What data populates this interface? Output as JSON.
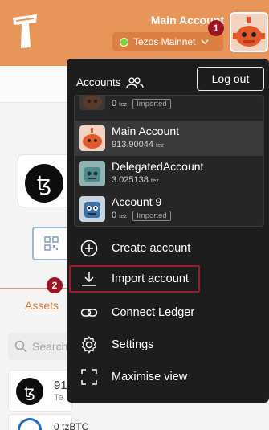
{
  "header": {
    "account_name": "Main Account",
    "network": "Tezos Mainnet",
    "network_status_color": "#7dd23a",
    "brand_color": "#e8955a"
  },
  "badges": [
    "1",
    "2"
  ],
  "background": {
    "assets_tab": "Assets",
    "search_placeholder": "Search",
    "asset_amount": "91",
    "asset_sub": "Te",
    "tzbtc": "0 tzBTC"
  },
  "menu": {
    "title": "Accounts",
    "logout": "Log out",
    "accounts": [
      {
        "name": "",
        "balance": "0",
        "unit": "tez",
        "tag": "Imported",
        "avatar": "robot-brown"
      },
      {
        "name": "Main Account",
        "balance": "913.90044",
        "unit": "tez",
        "tag": "",
        "avatar": "robot-orange",
        "selected": true
      },
      {
        "name": "DelegatedAccount",
        "balance": "3.025138",
        "unit": "tez",
        "tag": "",
        "avatar": "robot-teal"
      },
      {
        "name": "Account 9",
        "balance": "0",
        "unit": "tez",
        "tag": "Imported",
        "avatar": "robot-blue"
      }
    ],
    "actions": [
      {
        "label": "Create account",
        "icon": "plus-circle-icon"
      },
      {
        "label": "Import account",
        "icon": "download-icon"
      },
      {
        "label": "Connect Ledger",
        "icon": "link-icon"
      },
      {
        "label": "Settings",
        "icon": "gear-icon"
      },
      {
        "label": "Maximise view",
        "icon": "maximize-icon"
      }
    ]
  }
}
